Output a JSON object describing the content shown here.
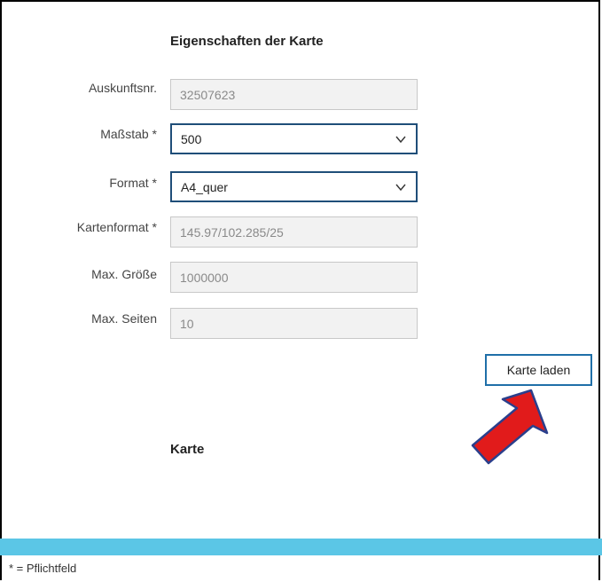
{
  "form": {
    "heading": "Eigenschaften der Karte",
    "fields": [
      {
        "label": "Auskunftsnr.",
        "value": "32507623",
        "kind": "readonly"
      },
      {
        "label": "Maßstab *",
        "value": "500",
        "kind": "select"
      },
      {
        "label": "Format *",
        "value": "A4_quer",
        "kind": "select"
      },
      {
        "label": "Kartenformat *",
        "value": "145.97/102.285/25",
        "kind": "readonly"
      },
      {
        "label": "Max. Größe",
        "value": "1000000",
        "kind": "readonly"
      },
      {
        "label": "Max. Seiten",
        "value": "10",
        "kind": "readonly"
      }
    ],
    "load_button": "Karte laden"
  },
  "map_section": {
    "heading": "Karte"
  },
  "footer": {
    "note": "* = Pflichtfeld"
  },
  "colors": {
    "accent_bar": "#5bc6e6",
    "select_border": "#1f4e79",
    "button_border": "#1f6fa8",
    "arrow_fill": "#e11b1b",
    "arrow_outline": "#2b3f8c"
  },
  "icons": {
    "select_toggle": "chevron-down-icon",
    "pointer": "red-arrow-annotation"
  }
}
